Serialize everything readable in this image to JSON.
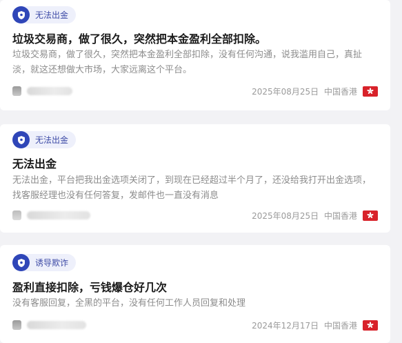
{
  "posts": [
    {
      "tag": "无法出金",
      "title": "垃圾交易商，做了很久，突然把本金盈利全部扣除。",
      "body": "垃圾交易商，做了很久，突然把本金盈利全部扣除，没有任何沟通，说我滥用自己，真扯淡，就这还想做大市场，大家远离这个平台。",
      "date": "2025年08月25日",
      "location": "中国香港"
    },
    {
      "tag": "无法出金",
      "title": "无法出金",
      "body": "无法出金，平台把我出金选项关闭了，到现在已经超过半个月了，还没给我打开出金选项，找客服经理也没有任何答复，发邮件也一直没有消息",
      "date": "2025年08月25日",
      "location": "中国香港"
    },
    {
      "tag": "诱导欺诈",
      "title": "盈利直接扣除，亏钱爆仓好几次",
      "body": "没有客服回复，全黑的平台，没有任何工作人员回复和处理",
      "date": "2024年12月17日",
      "location": "中国香港"
    }
  ],
  "colors": {
    "accent": "#2f46b8",
    "tag_bg": "#eef0fb",
    "flag_red": "#d8222a"
  },
  "icons": {
    "tag_badge": "shield-badge-icon",
    "flag": "hong-kong-flag-icon"
  }
}
